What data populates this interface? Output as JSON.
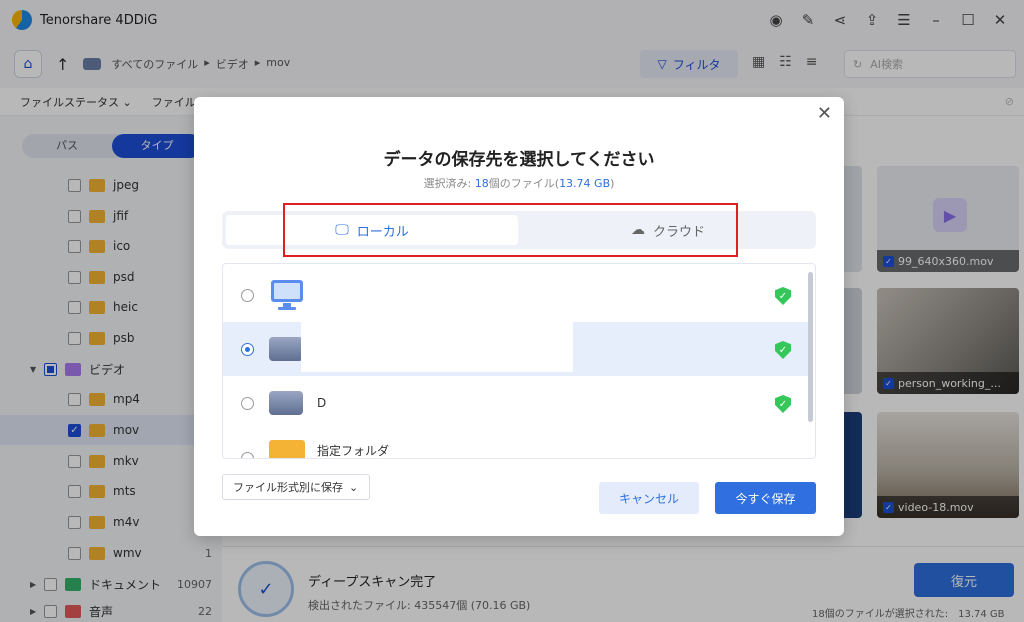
{
  "app": {
    "title": "Tenorshare 4DDiG",
    "window_icons": [
      "bot-icon",
      "pin-icon",
      "share-icon",
      "upload-icon",
      "menu-icon",
      "minimize-icon",
      "maximize-icon",
      "close-icon"
    ]
  },
  "toolbar": {
    "breadcrumb": [
      "すべてのファイル",
      "ビデオ",
      "mov"
    ],
    "filter_label": "フィルタ",
    "search_placeholder": "AI検索"
  },
  "filterrow": {
    "items": [
      "ファイルステータス",
      "ファイルの"
    ]
  },
  "sidebar": {
    "seg_path": "パス",
    "seg_type": "タイプ",
    "items": [
      {
        "label": "jpeg",
        "checked": "none"
      },
      {
        "label": "jfif",
        "checked": "none"
      },
      {
        "label": "ico",
        "checked": "none"
      },
      {
        "label": "psd",
        "checked": "none"
      },
      {
        "label": "heic",
        "checked": "none"
      },
      {
        "label": "psb",
        "checked": "none"
      },
      {
        "label": "ビデオ",
        "checked": "partial"
      },
      {
        "label": "mp4",
        "checked": "none"
      },
      {
        "label": "mov",
        "checked": "checked"
      },
      {
        "label": "mkv",
        "checked": "none"
      },
      {
        "label": "mts",
        "checked": "none"
      },
      {
        "label": "m4v",
        "checked": "none"
      },
      {
        "label": "wmv",
        "checked": "none",
        "count": "1"
      },
      {
        "label": "ドキュメント",
        "checked": "none",
        "count": "10907"
      },
      {
        "label": "音声",
        "checked": "none",
        "count": "22"
      }
    ]
  },
  "thumbnails": [
    {
      "label": "99_640x360.mov"
    },
    {
      "label": "person_working_..."
    },
    {
      "label": "video-18.mov"
    }
  ],
  "bottom": {
    "scan_title": "ディープスキャン完了",
    "scan_sub": "検出されたファイル: 435547個 (70.16 GB)",
    "recover_label": "復元",
    "selected_info": "18個のファイルが選択された:　13.74 GB"
  },
  "dialog": {
    "title": "データの保存先を選択してください",
    "sub_prefix": "選択済み: ",
    "sub_count": "18",
    "sub_mid": "個のファイル(",
    "sub_size": "13.74 GB",
    "sub_suffix": ")",
    "tab_local": "ローカル",
    "tab_cloud": "クラウド",
    "rows": [
      {
        "label": "",
        "icon": "monitor-icon",
        "selected": false
      },
      {
        "label": "",
        "icon": "drive-icon",
        "selected": true
      },
      {
        "label": "D",
        "icon": "drive-icon",
        "selected": false
      },
      {
        "label": "指定フォルダ",
        "icon": "folder-icon",
        "selected": false
      }
    ],
    "format_label": "ファイル形式別に保存",
    "cancel_label": "キャンセル",
    "save_label": "今すぐ保存"
  },
  "colors": {
    "accent": "#2f6fe0",
    "highlight": "#e02020",
    "shield": "#34c759"
  }
}
